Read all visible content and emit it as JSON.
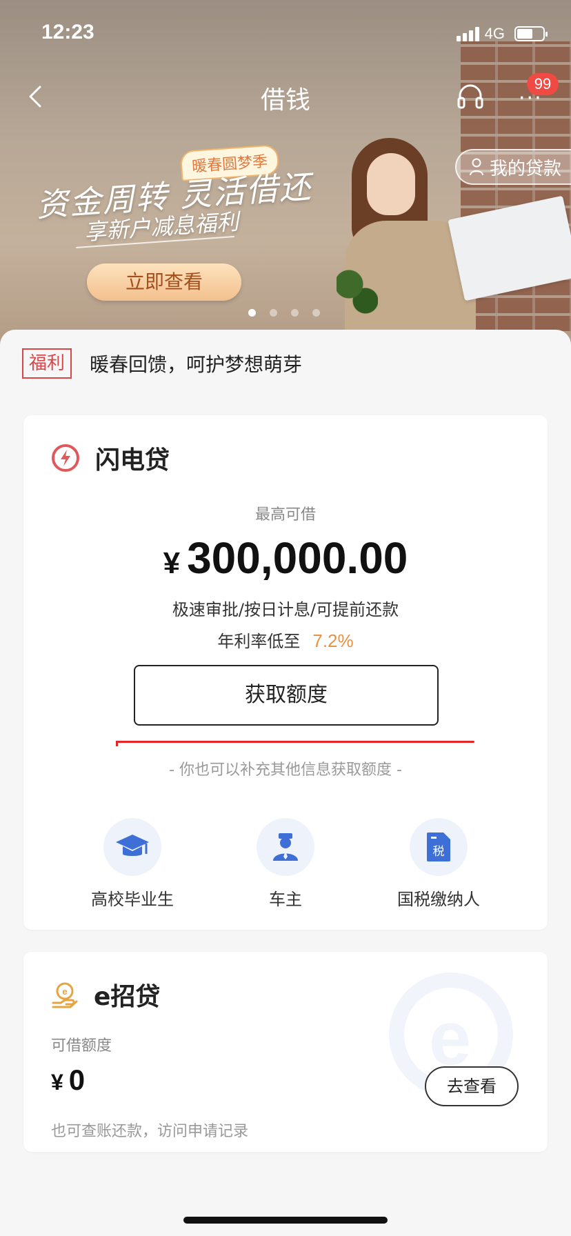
{
  "status_bar": {
    "time": "12:23",
    "network": "4G"
  },
  "nav": {
    "title": "借钱",
    "badge_count": "99",
    "my_loans_label": "我的贷款"
  },
  "banner": {
    "tag": "暖春圆梦季",
    "headline": "资金周转 灵活借还",
    "subheadline": "享新户减息福利",
    "button_label": "立即查看",
    "slides": 4,
    "active_slide": 1
  },
  "notice": {
    "tag": "福利",
    "text": "暖春回馈，呵护梦想萌芽"
  },
  "flash_loan": {
    "title": "闪电贷",
    "max_label": "最高可借",
    "currency": "¥",
    "amount": "300,000.00",
    "features": "极速审批/按日计息/可提前还款",
    "rate_label": "年利率低至",
    "rate_value": "7.2%",
    "cta_label": "获取额度",
    "hint": "- 你也可以补充其他信息获取额度 -",
    "options": [
      {
        "label": "高校毕业生",
        "icon": "graduation-cap-icon"
      },
      {
        "label": "车主",
        "icon": "driver-icon"
      },
      {
        "label": "国税缴纳人",
        "icon": "tax-document-icon",
        "glyph": "税"
      }
    ]
  },
  "e_loan": {
    "title": "e招贷",
    "available_label": "可借额度",
    "currency": "¥",
    "amount": "0",
    "view_button": "去查看",
    "note": "也可查账还款，访问申请记录"
  },
  "colors": {
    "accent_orange": "#e89140",
    "alert_red": "#d8464a",
    "icon_blue": "#3d6fd6"
  }
}
